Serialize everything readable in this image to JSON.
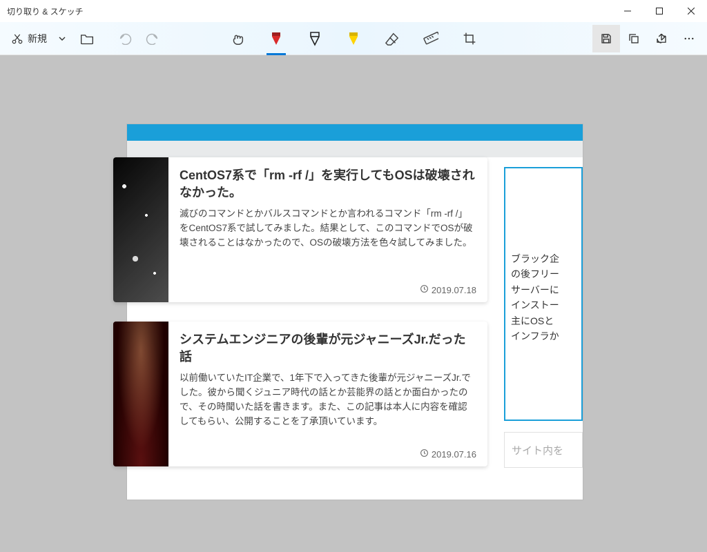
{
  "window": {
    "title": "切り取り & スケッチ"
  },
  "toolbar": {
    "new_label": "新規"
  },
  "screenshot": {
    "articles": [
      {
        "title": "CentOS7系で「rm -rf /」を実行してもOSは破壊されなかった。",
        "excerpt": "滅びのコマンドとかバルスコマンドとか言われるコマンド「rm -rf /」 をCentOS7系で試してみました。結果として、このコマンドでOSが破壊されることはなかったので、OSの破壊方法を色々試してみました。",
        "date": "2019.07.18"
      },
      {
        "title": "システムエンジニアの後輩が元ジャニーズJr.だった話",
        "excerpt": "以前働いていたIT企業で、1年下で入ってきた後輩が元ジャニーズJr.でした。彼から聞くジュニア時代の話とか芸能界の話とか面白かったので、その時聞いた話を書きます。また、この記事は本人に内容を確認してもらい、公開することを了承頂いています。",
        "date": "2019.07.16"
      }
    ],
    "profile_text": "ブラック企\nの後フリー\nサーバーに\nインストー\n主にOSと\nインフラか",
    "search_placeholder": "サイト内を"
  }
}
